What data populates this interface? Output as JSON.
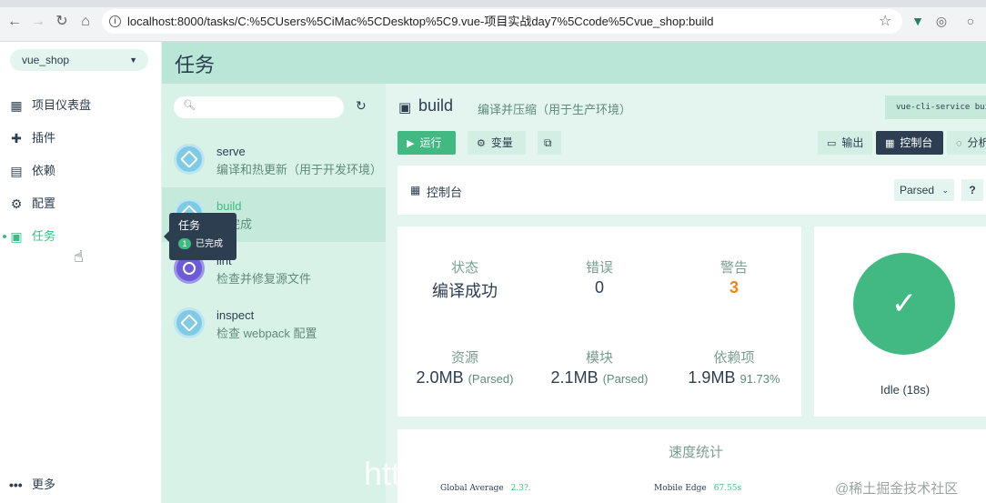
{
  "browser": {
    "url": "localhost:8000/tasks/C:%5CUsers%5CiMac%5CDesktop%5C9.vue-项目实战day7%5Ccode%5Cvue_shop:build"
  },
  "project": {
    "name": "vue_shop"
  },
  "nav": {
    "items": [
      {
        "label": "项目仪表盘"
      },
      {
        "label": "插件"
      },
      {
        "label": "依赖"
      },
      {
        "label": "配置"
      },
      {
        "label": "任务"
      }
    ],
    "more": "更多"
  },
  "tooltip": {
    "title": "任务",
    "count": "1",
    "status": "已完成"
  },
  "page": {
    "title": "任务"
  },
  "tasks": [
    {
      "name": "serve",
      "desc": "编译和热更新（用于开发环境）"
    },
    {
      "name": "build",
      "desc": "已完成"
    },
    {
      "name": "lint",
      "desc": "检查并修复源文件"
    },
    {
      "name": "inspect",
      "desc": "检查 webpack 配置"
    }
  ],
  "detail": {
    "name": "build",
    "desc": "编译并压缩（用于生产环境）",
    "command": "vue-cli-service build",
    "buttons": {
      "run": "运行",
      "vars": "变量",
      "output": "输出",
      "dashboard": "控制台",
      "analyze": "分析"
    },
    "panel_title": "控制台",
    "parsed": "Parsed",
    "stats": {
      "status_label": "状态",
      "status_value": "编译成功",
      "errors_label": "错误",
      "errors_value": "0",
      "warnings_label": "警告",
      "warnings_value": "3",
      "assets_label": "资源",
      "assets_value": "2.0MB",
      "assets_sub": "(Parsed)",
      "modules_label": "模块",
      "modules_value": "2.1MB",
      "modules_sub": "(Parsed)",
      "deps_label": "依赖项",
      "deps_value": "1.9MB",
      "deps_sub": "91.73%"
    },
    "idle": "Idle (18s)",
    "speed_title": "速度统计",
    "speed": [
      {
        "label": "Global Average",
        "value": "2.3?."
      },
      {
        "label": "Mobile Edge",
        "value": "67.55s"
      }
    ]
  },
  "watermark": "@稀土掘金技术社区",
  "overlay_text": "htt"
}
